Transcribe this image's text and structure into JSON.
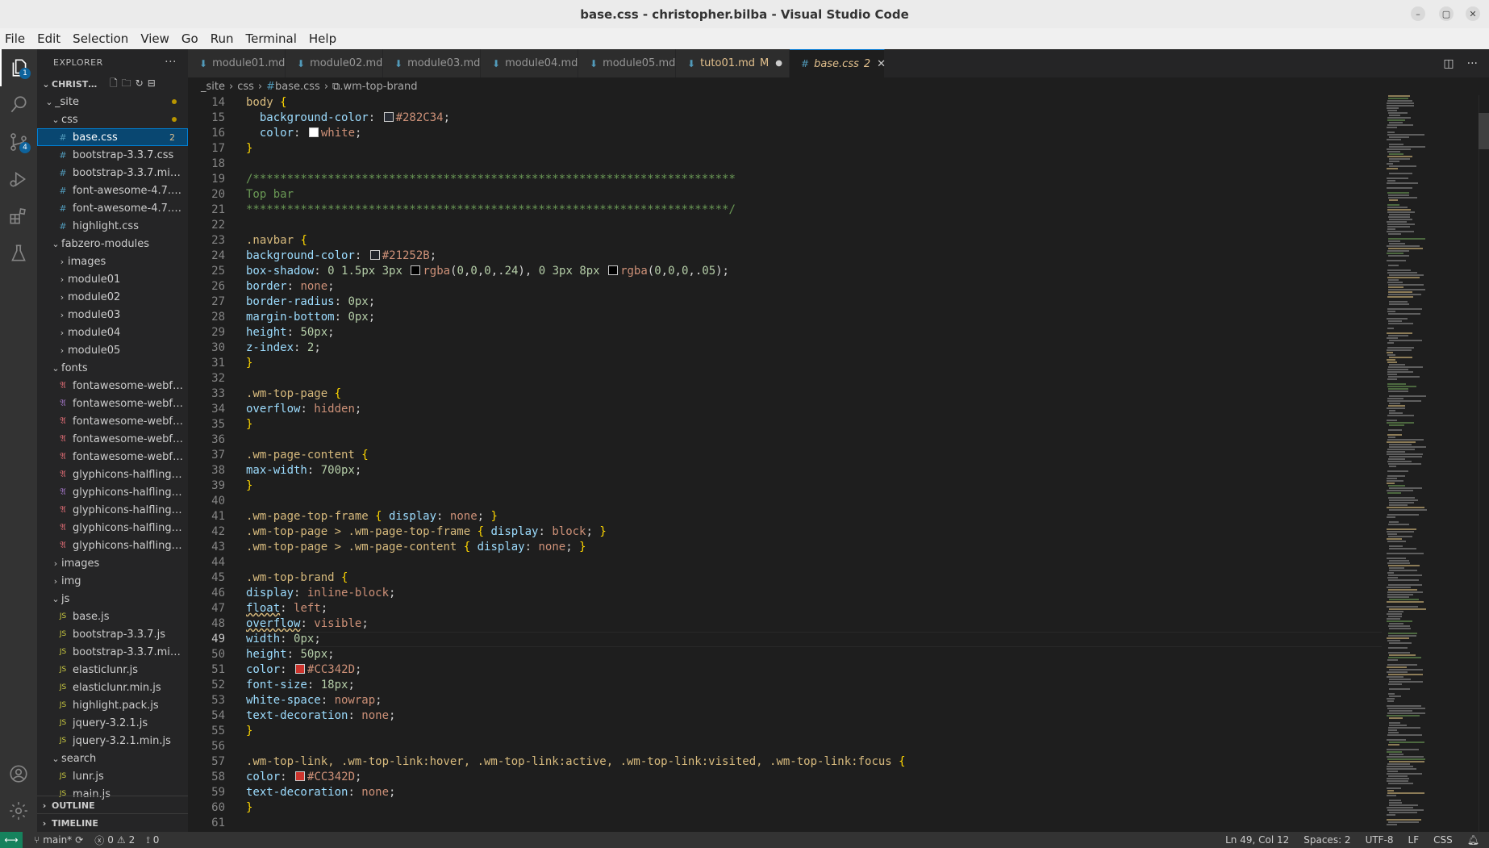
{
  "window": {
    "title": "base.css - christopher.bilba - Visual Studio Code"
  },
  "menu": [
    "File",
    "Edit",
    "Selection",
    "View",
    "Go",
    "Run",
    "Terminal",
    "Help"
  ],
  "activity": {
    "explorer_badge": "1",
    "scm_badge": "4"
  },
  "sidebar": {
    "title": "EXPLORER",
    "root": "CHRISTOP...",
    "tree": [
      {
        "depth": 0,
        "type": "folder",
        "open": true,
        "label": "_site",
        "dot": true
      },
      {
        "depth": 1,
        "type": "folder",
        "open": true,
        "label": "css",
        "dot": true
      },
      {
        "depth": 2,
        "type": "css",
        "label": "base.css",
        "count": "2",
        "selected": true
      },
      {
        "depth": 2,
        "type": "css",
        "label": "bootstrap-3.3.7.css"
      },
      {
        "depth": 2,
        "type": "css",
        "label": "bootstrap-3.3.7.min...."
      },
      {
        "depth": 2,
        "type": "css",
        "label": "font-awesome-4.7.0...."
      },
      {
        "depth": 2,
        "type": "css",
        "label": "font-awesome-4.7.0...."
      },
      {
        "depth": 2,
        "type": "css",
        "label": "highlight.css"
      },
      {
        "depth": 1,
        "type": "folder",
        "open": true,
        "label": "fabzero-modules"
      },
      {
        "depth": 2,
        "type": "folder",
        "open": false,
        "label": "images"
      },
      {
        "depth": 2,
        "type": "folder",
        "open": false,
        "label": "module01"
      },
      {
        "depth": 2,
        "type": "folder",
        "open": false,
        "label": "module02"
      },
      {
        "depth": 2,
        "type": "folder",
        "open": false,
        "label": "module03"
      },
      {
        "depth": 2,
        "type": "folder",
        "open": false,
        "label": "module04"
      },
      {
        "depth": 2,
        "type": "folder",
        "open": false,
        "label": "module05"
      },
      {
        "depth": 1,
        "type": "folder",
        "open": true,
        "label": "fonts"
      },
      {
        "depth": 2,
        "type": "font",
        "label": "fontawesome-webfo..."
      },
      {
        "depth": 2,
        "type": "svgfont",
        "label": "fontawesome-webfo..."
      },
      {
        "depth": 2,
        "type": "font",
        "label": "fontawesome-webfo..."
      },
      {
        "depth": 2,
        "type": "font",
        "label": "fontawesome-webfo..."
      },
      {
        "depth": 2,
        "type": "font",
        "label": "fontawesome-webfo..."
      },
      {
        "depth": 2,
        "type": "font",
        "label": "glyphicons-halflings-..."
      },
      {
        "depth": 2,
        "type": "svgfont",
        "label": "glyphicons-halflings-..."
      },
      {
        "depth": 2,
        "type": "font",
        "label": "glyphicons-halflings-..."
      },
      {
        "depth": 2,
        "type": "font",
        "label": "glyphicons-halflings-..."
      },
      {
        "depth": 2,
        "type": "font",
        "label": "glyphicons-halflings-..."
      },
      {
        "depth": 1,
        "type": "folder",
        "open": false,
        "label": "images"
      },
      {
        "depth": 1,
        "type": "folder",
        "open": false,
        "label": "img"
      },
      {
        "depth": 1,
        "type": "folder",
        "open": true,
        "label": "js"
      },
      {
        "depth": 2,
        "type": "js",
        "label": "base.js"
      },
      {
        "depth": 2,
        "type": "js",
        "label": "bootstrap-3.3.7.js"
      },
      {
        "depth": 2,
        "type": "js",
        "label": "bootstrap-3.3.7.min.js"
      },
      {
        "depth": 2,
        "type": "js",
        "label": "elasticlunr.js"
      },
      {
        "depth": 2,
        "type": "js",
        "label": "elasticlunr.min.js"
      },
      {
        "depth": 2,
        "type": "js",
        "label": "highlight.pack.js"
      },
      {
        "depth": 2,
        "type": "js",
        "label": "jquery-3.2.1.js"
      },
      {
        "depth": 2,
        "type": "js",
        "label": "jquery-3.2.1.min.js"
      },
      {
        "depth": 1,
        "type": "folder",
        "open": true,
        "label": "search"
      },
      {
        "depth": 2,
        "type": "js",
        "label": "lunr.js"
      },
      {
        "depth": 2,
        "type": "js",
        "label": "main.js"
      }
    ],
    "outline": "OUTLINE",
    "timeline": "TIMELINE"
  },
  "tabs": [
    {
      "label": "module01.md",
      "active": false
    },
    {
      "label": "module02.md",
      "active": false
    },
    {
      "label": "module03.md",
      "active": false
    },
    {
      "label": "module04.md",
      "active": false
    },
    {
      "label": "module05.md",
      "active": false
    },
    {
      "label": "tuto01.md",
      "active": false,
      "suffix": "M",
      "dirty": true
    },
    {
      "label": "base.css",
      "active": true,
      "suffix": "2"
    }
  ],
  "breadcrumb": [
    "_site",
    "css",
    "base.css",
    ".wm-top-brand"
  ],
  "editor": {
    "current_line": 49,
    "lines": [
      {
        "n": 14,
        "t": "body {"
      },
      {
        "n": 15,
        "t": "  background-color: #282C34;",
        "sw": "#282C34"
      },
      {
        "n": 16,
        "t": "  color: white;",
        "sw": "#ffffff"
      },
      {
        "n": 17,
        "t": "}"
      },
      {
        "n": 18,
        "t": ""
      },
      {
        "n": 19,
        "t": "/***********************************************************************",
        "c": true
      },
      {
        "n": 20,
        "t": "Top bar",
        "c": true
      },
      {
        "n": 21,
        "t": "***********************************************************************/",
        "c": true
      },
      {
        "n": 22,
        "t": ""
      },
      {
        "n": 23,
        "t": ".navbar {"
      },
      {
        "n": 24,
        "t": "background-color: #21252B;",
        "sw": "#21252B"
      },
      {
        "n": 25,
        "t": "box-shadow: 0 1.5px 3px rgba(0,0,0,.24), 0 3px 8px rgba(0,0,0,.05);"
      },
      {
        "n": 26,
        "t": "border: none;"
      },
      {
        "n": 27,
        "t": "border-radius: 0px;"
      },
      {
        "n": 28,
        "t": "margin-bottom: 0px;"
      },
      {
        "n": 29,
        "t": "height: 50px;"
      },
      {
        "n": 30,
        "t": "z-index: 2;"
      },
      {
        "n": 31,
        "t": "}"
      },
      {
        "n": 32,
        "t": ""
      },
      {
        "n": 33,
        "t": ".wm-top-page {"
      },
      {
        "n": 34,
        "t": "overflow: hidden;"
      },
      {
        "n": 35,
        "t": "}"
      },
      {
        "n": 36,
        "t": ""
      },
      {
        "n": 37,
        "t": ".wm-page-content {"
      },
      {
        "n": 38,
        "t": "max-width: 700px;"
      },
      {
        "n": 39,
        "t": "}"
      },
      {
        "n": 40,
        "t": ""
      },
      {
        "n": 41,
        "t": ".wm-page-top-frame { display: none; }"
      },
      {
        "n": 42,
        "t": ".wm-top-page > .wm-page-top-frame { display: block; }"
      },
      {
        "n": 43,
        "t": ".wm-top-page > .wm-page-content { display: none; }"
      },
      {
        "n": 44,
        "t": ""
      },
      {
        "n": 45,
        "t": ".wm-top-brand {"
      },
      {
        "n": 46,
        "t": "display: inline-block;"
      },
      {
        "n": 47,
        "t": "float: left;"
      },
      {
        "n": 48,
        "t": "overflow: visible;"
      },
      {
        "n": 49,
        "t": "width: 0px;"
      },
      {
        "n": 50,
        "t": "height: 50px;"
      },
      {
        "n": 51,
        "t": "color: #CC342D;",
        "sw": "#CC342D"
      },
      {
        "n": 52,
        "t": "font-size: 18px;"
      },
      {
        "n": 53,
        "t": "white-space: nowrap;"
      },
      {
        "n": 54,
        "t": "text-decoration: none;"
      },
      {
        "n": 55,
        "t": "}"
      },
      {
        "n": 56,
        "t": ""
      },
      {
        "n": 57,
        "t": ".wm-top-link, .wm-top-link:hover, .wm-top-link:active, .wm-top-link:visited, .wm-top-link:focus {"
      },
      {
        "n": 58,
        "t": "color: #CC342D;",
        "sw": "#CC342D"
      },
      {
        "n": 59,
        "t": "text-decoration: none;"
      },
      {
        "n": 60,
        "t": "}"
      },
      {
        "n": 61,
        "t": ""
      }
    ]
  },
  "status": {
    "branch": "main*",
    "errors": "0",
    "warnings": "2",
    "ports": "0",
    "position": "Ln 49, Col 12",
    "spaces": "Spaces: 2",
    "encoding": "UTF-8",
    "eol": "LF",
    "language": "CSS"
  },
  "colors": {
    "accent": "#0078d4",
    "statusbar": "#333333",
    "modified": "#e2c08d"
  }
}
